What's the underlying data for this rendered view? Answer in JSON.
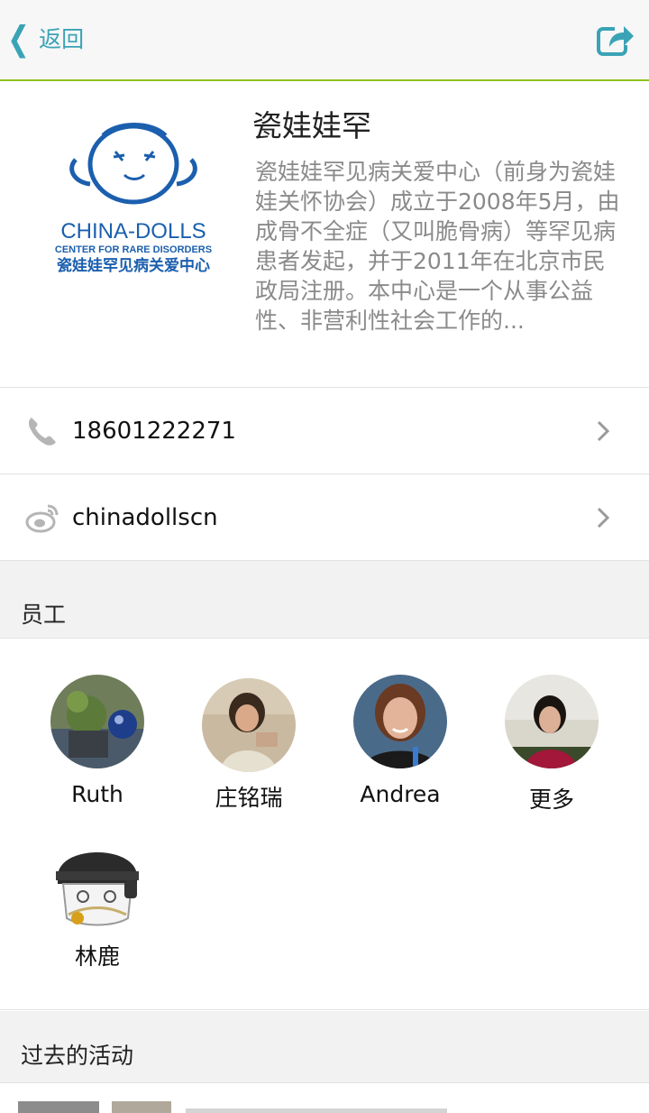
{
  "nav": {
    "back_label": "返回",
    "share_icon": "share-icon"
  },
  "org": {
    "name": "瓷娃娃罕",
    "description": "瓷娃娃罕见病关爱中心（前身为瓷娃娃关怀协会）成立于2008年5月，由成骨不全症（又叫脆骨病）等罕见病患者发起，并于2011年在北京市民政局注册。本中心是一个从事公益性、非营利性社会工作的...",
    "logo": {
      "title": "CHINA-DOLLS",
      "subtitle": "CENTER FOR RARE DISORDERS",
      "chinese": "瓷娃娃罕见病关爱中心"
    }
  },
  "contacts": {
    "phone": "18601222271",
    "weibo": "chinadollscn"
  },
  "staff": {
    "title": "员工",
    "members": [
      {
        "name": "Ruth"
      },
      {
        "name": "庄铭瑞"
      },
      {
        "name": "Andrea"
      },
      {
        "name": "更多"
      },
      {
        "name": "林鹿"
      }
    ]
  },
  "activities": {
    "title": "过去的活动"
  },
  "colors": {
    "accent": "#3aa3b6",
    "nav_border": "#8dc21f",
    "logo_blue": "#1b5fae"
  }
}
